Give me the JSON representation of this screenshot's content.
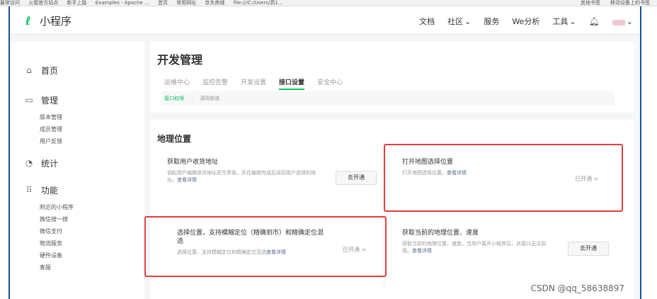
{
  "bookmarks": [
    "最常访问",
    "火狐官方站点",
    "新手上路",
    "Examples - Apache ...",
    "首页",
    "常用网址",
    "京东商城",
    "file:///C:/Users/高1...",
    "其他书签",
    "移动设备上的书签"
  ],
  "brand": {
    "name": "小程序",
    "color": "#07c160"
  },
  "topnav": {
    "items": [
      "文档",
      "社区",
      "服务",
      "We分析",
      "工具"
    ],
    "bell_icon": "bell-icon"
  },
  "sidebar": {
    "groups": [
      {
        "label": "首页",
        "icon": "home-icon",
        "items": []
      },
      {
        "label": "管理",
        "icon": "monitor-icon",
        "items": [
          "版本管理",
          "成员管理",
          "用户反馈"
        ]
      },
      {
        "label": "统计",
        "icon": "chart-icon",
        "items": []
      },
      {
        "label": "功能",
        "icon": "grid-icon",
        "items": [
          "附近的小程序",
          "微信搜一搜",
          "微信支付",
          "物流服务",
          "硬件设备",
          "客服"
        ]
      }
    ]
  },
  "page": {
    "title": "开发管理",
    "tabs": [
      "运维中心",
      "监控告警",
      "开发设置",
      "接口设置",
      "安全中心"
    ],
    "active_tab": "接口设置",
    "subtabs": [
      "接口权限",
      "调用额度"
    ],
    "active_subtab": "接口权限"
  },
  "section": {
    "title": "地理位置",
    "features": [
      {
        "title": "获取用户收货地址",
        "desc": "调起用户编辑收货地址原生界面，并在编辑完成后返回用户选择的地址。",
        "link": "查看详情",
        "action": "去开通"
      },
      {
        "title": "打开地图选择位置",
        "desc": "打开地图选择位置。",
        "link": "查看详情",
        "status": "已开通 >"
      },
      {
        "title": "选择位置，支持模糊定位（精确到市）和精确定位混选",
        "desc": "选择位置，支持模糊定位和精确定位混选",
        "link": "查看详情",
        "status": "已开通 >"
      },
      {
        "title": "获取当前的地理位置、速度",
        "desc": "获取当前的地理位置、速度。当用户离开小程序后，此接口无法调用。",
        "link": "查看详情",
        "action": "去开通"
      }
    ]
  },
  "watermark": "CSDN @qq_58638897",
  "colors": {
    "accent": "#07c160",
    "highlight": "#e43d3d",
    "link": "#576b95"
  }
}
